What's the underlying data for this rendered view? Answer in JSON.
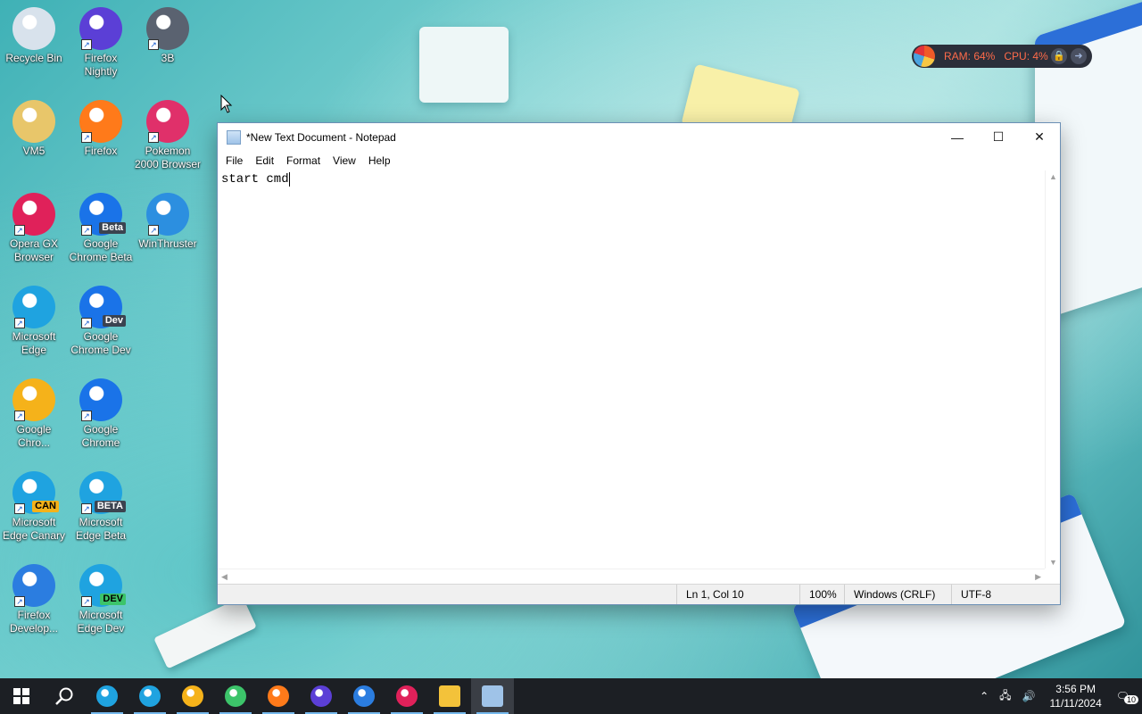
{
  "desktop": {
    "icons": [
      {
        "label": "Recycle Bin",
        "icon": "recycle-bin-icon",
        "color": "#d8e2ec"
      },
      {
        "label": "Firefox Nightly",
        "icon": "firefox-nightly-icon",
        "color": "#5b3fd6"
      },
      {
        "label": "3B",
        "icon": "3b-icon",
        "color": "#5a6270"
      },
      {
        "label": "VM5",
        "icon": "user-folder-icon",
        "color": "#e8c66a"
      },
      {
        "label": "Firefox",
        "icon": "firefox-icon",
        "color": "#ff7a1a"
      },
      {
        "label": "Pokemon 2000 Browser",
        "icon": "pokeball-icon",
        "color": "#e0306a"
      },
      {
        "label": "Opera GX Browser",
        "icon": "opera-gx-icon",
        "color": "#e0215a"
      },
      {
        "label": "Google Chrome Beta",
        "icon": "chrome-beta-icon",
        "color": "#1a73e8",
        "badge": "Beta"
      },
      {
        "label": "WinThruster",
        "icon": "winthruster-icon",
        "color": "#2c8fe0"
      },
      {
        "label": "Microsoft Edge",
        "icon": "edge-icon",
        "color": "#1fa3e0"
      },
      {
        "label": "Google Chrome Dev",
        "icon": "chrome-dev-icon",
        "color": "#1a73e8",
        "badge": "Dev"
      },
      {
        "label": "Google Chro...",
        "icon": "chrome-canary-icon",
        "color": "#f5b21a"
      },
      {
        "label": "Google Chrome",
        "icon": "chrome-icon",
        "color": "#1a73e8"
      },
      {
        "label": "Microsoft Edge Canary",
        "icon": "edge-canary-icon",
        "color": "#1fa3e0",
        "badge": "CAN"
      },
      {
        "label": "Microsoft Edge Beta",
        "icon": "edge-beta-icon",
        "color": "#1fa3e0",
        "badge": "BETA"
      },
      {
        "label": "Firefox Develop...",
        "icon": "firefox-dev-icon",
        "color": "#2b7de0"
      },
      {
        "label": "Microsoft Edge Dev",
        "icon": "edge-dev-icon",
        "color": "#1fa3e0",
        "badge": "DEV"
      }
    ]
  },
  "sysmon": {
    "ram": "RAM: 64%",
    "cpu": "CPU: 4%"
  },
  "notepad": {
    "title": "*New Text Document - Notepad",
    "menu": [
      "File",
      "Edit",
      "Format",
      "View",
      "Help"
    ],
    "content": "start cmd",
    "status": {
      "position": "Ln 1, Col 10",
      "zoom": "100%",
      "line_ending": "Windows (CRLF)",
      "encoding": "UTF-8"
    }
  },
  "taskbar": {
    "apps": [
      {
        "icon": "edge-icon",
        "color": "#1fa3e0"
      },
      {
        "icon": "edge-beta-icon",
        "color": "#1fa3e0"
      },
      {
        "icon": "edge-canary-icon",
        "color": "#f5b21a"
      },
      {
        "icon": "edge-dev-icon",
        "color": "#3cc46a"
      },
      {
        "icon": "firefox-icon",
        "color": "#ff7a1a"
      },
      {
        "icon": "firefox-nightly-icon",
        "color": "#5b3fd6"
      },
      {
        "icon": "firefox-dev-icon",
        "color": "#2b7de0"
      },
      {
        "icon": "opera-icon",
        "color": "#e0215a"
      },
      {
        "icon": "file-explorer-icon",
        "color": "#f3c23a"
      },
      {
        "icon": "notepad-icon",
        "color": "#9fc3e8"
      }
    ],
    "time": "3:56 PM",
    "date": "11/11/2024",
    "notifications": "10"
  }
}
